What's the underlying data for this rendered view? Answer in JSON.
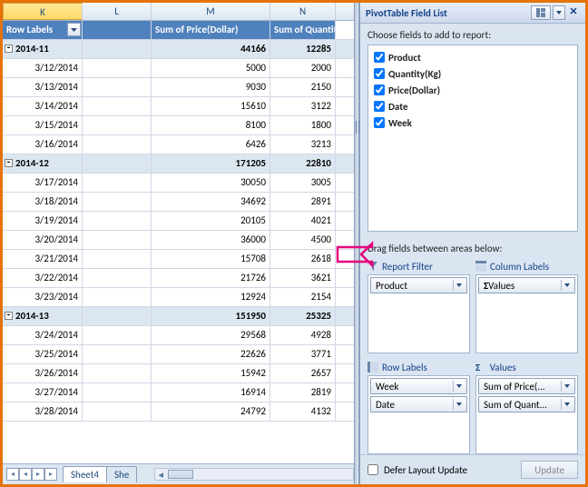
{
  "columns": {
    "K": "K",
    "L": "L",
    "M": "M",
    "N": "N"
  },
  "headers": {
    "rowlabels": "Row Labels",
    "price": "Sum of Price(Dollar)",
    "qty": "Sum of Quantity(Kg)"
  },
  "rows": [
    {
      "t": "sub",
      "label": "2014-11",
      "price": "44166",
      "qty": "12285"
    },
    {
      "t": "d",
      "label": "3/12/2014",
      "price": "5000",
      "qty": "2000"
    },
    {
      "t": "d",
      "label": "3/13/2014",
      "price": "9030",
      "qty": "2150"
    },
    {
      "t": "d",
      "label": "3/14/2014",
      "price": "15610",
      "qty": "3122"
    },
    {
      "t": "d",
      "label": "3/15/2014",
      "price": "8100",
      "qty": "1800"
    },
    {
      "t": "d",
      "label": "3/16/2014",
      "price": "6426",
      "qty": "3213"
    },
    {
      "t": "sub",
      "label": "2014-12",
      "price": "171205",
      "qty": "22810"
    },
    {
      "t": "d",
      "label": "3/17/2014",
      "price": "30050",
      "qty": "3005"
    },
    {
      "t": "d",
      "label": "3/18/2014",
      "price": "34692",
      "qty": "2891"
    },
    {
      "t": "d",
      "label": "3/19/2014",
      "price": "20105",
      "qty": "4021"
    },
    {
      "t": "d",
      "label": "3/20/2014",
      "price": "36000",
      "qty": "4500"
    },
    {
      "t": "d",
      "label": "3/21/2014",
      "price": "15708",
      "qty": "2618"
    },
    {
      "t": "d",
      "label": "3/22/2014",
      "price": "21726",
      "qty": "3621"
    },
    {
      "t": "d",
      "label": "3/23/2014",
      "price": "12924",
      "qty": "2154"
    },
    {
      "t": "sub",
      "label": "2014-13",
      "price": "151950",
      "qty": "25325"
    },
    {
      "t": "d",
      "label": "3/24/2014",
      "price": "29568",
      "qty": "4928"
    },
    {
      "t": "d",
      "label": "3/25/2014",
      "price": "22626",
      "qty": "3771"
    },
    {
      "t": "d",
      "label": "3/26/2014",
      "price": "15942",
      "qty": "2657"
    },
    {
      "t": "d",
      "label": "3/27/2014",
      "price": "16914",
      "qty": "2819"
    },
    {
      "t": "d",
      "label": "3/28/2014",
      "price": "24792",
      "qty": "4132"
    }
  ],
  "tabs": {
    "a": "Sheet4",
    "b": "She"
  },
  "pane": {
    "title": "PivotTable Field List",
    "choose": "Choose fields to add to report:",
    "fields": [
      "Product",
      "Quantity(Kg)",
      "Price(Dollar)",
      "Date",
      "Week"
    ],
    "drag": "Drag fields between areas below:",
    "areaTitles": {
      "filter": "Report Filter",
      "col": "Column Labels",
      "row": "Row Labels",
      "val": "Values"
    },
    "filter": [
      "Product"
    ],
    "colvals": [
      "Values"
    ],
    "rowvals": [
      "Week",
      "Date"
    ],
    "sigvals": [
      "Sum of Price(...",
      "Sum of Quant..."
    ],
    "defer": "Defer Layout Update",
    "update": "Update",
    "sigma": "Σ"
  }
}
